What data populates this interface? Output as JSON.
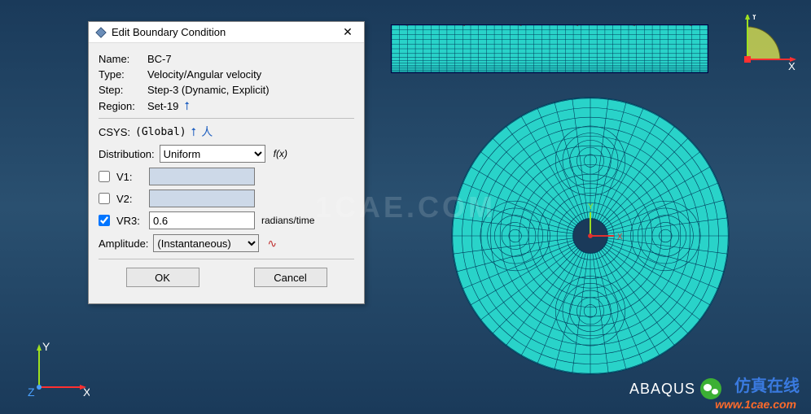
{
  "dialog": {
    "title": "Edit Boundary Condition",
    "name_label": "Name:",
    "name_value": "BC-7",
    "type_label": "Type:",
    "type_value": "Velocity/Angular velocity",
    "step_label": "Step:",
    "step_value": "Step-3 (Dynamic, Explicit)",
    "region_label": "Region:",
    "region_value": "Set-19",
    "csys_label": "CSYS:",
    "csys_value": "(Global)",
    "distribution_label": "Distribution:",
    "distribution_value": "Uniform",
    "fx_label": "f(x)",
    "v1_label": "V1:",
    "v1_checked": false,
    "v1_value": "",
    "v2_label": "V2:",
    "v2_checked": false,
    "v2_value": "",
    "vr3_label": "VR3:",
    "vr3_checked": true,
    "vr3_value": "0.6",
    "vr3_unit": "radians/time",
    "amplitude_label": "Amplitude:",
    "amplitude_value": "(Instantaneous)",
    "ok": "OK",
    "cancel": "Cancel"
  },
  "axes": {
    "x": "X",
    "y": "Y",
    "z": "Z"
  },
  "branding": {
    "product": "ABAQUS",
    "cn_text": "仿真在线",
    "url": "www.1cae.com",
    "watermark": "1CAE.COM"
  },
  "colors": {
    "mesh_fill": "#29d3c9",
    "mesh_line": "#003a5a",
    "arrow": "#ff7a1a"
  }
}
